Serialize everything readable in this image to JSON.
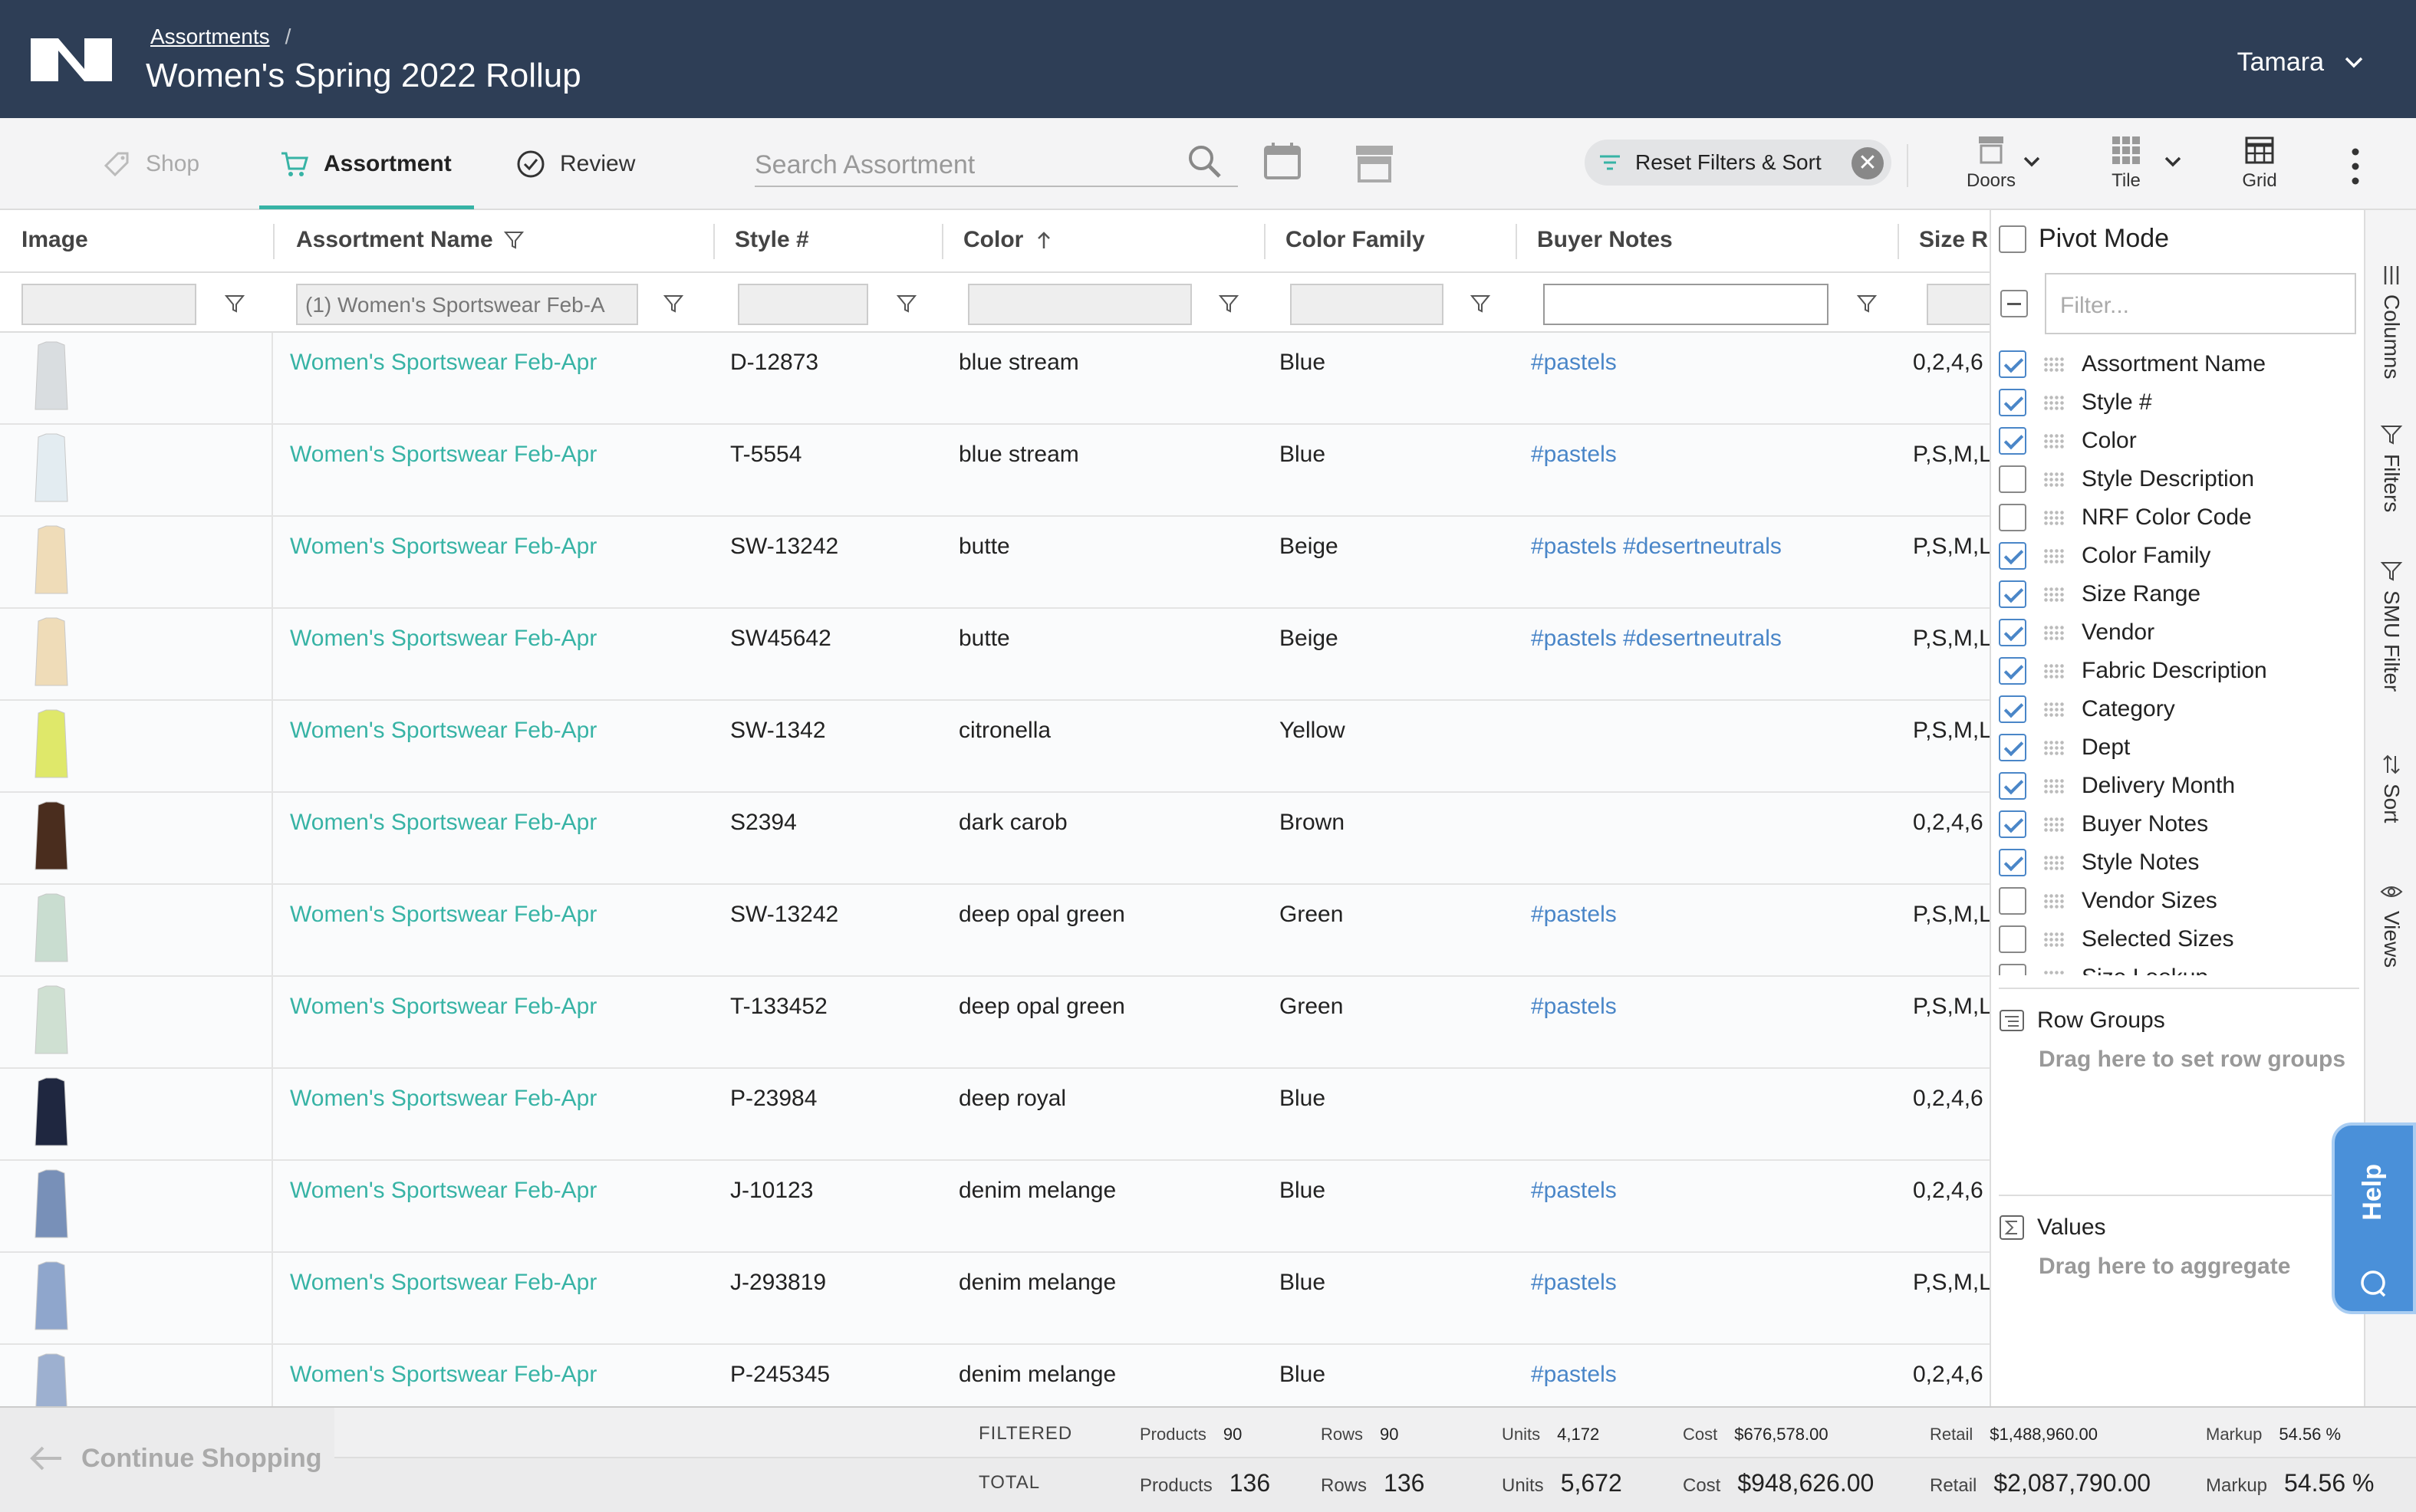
{
  "header": {
    "breadcrumb": "Assortments",
    "breadcrumb_sep": "/",
    "title": "Women's Spring 2022 Rollup",
    "user": "Tamara"
  },
  "toolbar": {
    "tabs": [
      {
        "label": "Shop",
        "icon": "tag-icon"
      },
      {
        "label": "Assortment",
        "icon": "cart-icon",
        "active": true
      },
      {
        "label": "Review",
        "icon": "check-circle-icon"
      }
    ],
    "search_placeholder": "Search Assortment",
    "reset_label": "Reset Filters & Sort",
    "doors_label": "Doors",
    "tile_label": "Tile",
    "grid_label": "Grid"
  },
  "grid": {
    "columns": [
      "Image",
      "Assortment Name",
      "Style #",
      "Color",
      "Color Family",
      "Buyer Notes",
      "Size R"
    ],
    "filters": {
      "assortment_name": "(1) Women's Sportswear Feb-A"
    },
    "rows": [
      {
        "name": "Women's Sportswear Feb-Apr",
        "style": "D-12873",
        "color": "blue stream",
        "family": "Blue",
        "notes": "#pastels",
        "size": "0,2,4,6",
        "thumb": "#d9dde0"
      },
      {
        "name": "Women's Sportswear Feb-Apr",
        "style": "T-5554",
        "color": "blue stream",
        "family": "Blue",
        "notes": "#pastels",
        "size": "P,S,M,L",
        "thumb": "#e3ecf1"
      },
      {
        "name": "Women's Sportswear Feb-Apr",
        "style": "SW-13242",
        "color": "butte",
        "family": "Beige",
        "notes": "#pastels #desertneutrals",
        "size": "P,S,M,L",
        "thumb": "#efdcb8"
      },
      {
        "name": "Women's Sportswear Feb-Apr",
        "style": "SW45642",
        "color": "butte",
        "family": "Beige",
        "notes": "#pastels #desertneutrals",
        "size": "P,S,M,L",
        "thumb": "#efdcb8"
      },
      {
        "name": "Women's Sportswear Feb-Apr",
        "style": "SW-1342",
        "color": "citronella",
        "family": "Yellow",
        "notes": "",
        "size": "P,S,M,L",
        "thumb": "#dfe86a"
      },
      {
        "name": "Women's Sportswear Feb-Apr",
        "style": "S2394",
        "color": "dark carob",
        "family": "Brown",
        "notes": "",
        "size": "0,2,4,6",
        "thumb": "#4a2d1e"
      },
      {
        "name": "Women's Sportswear Feb-Apr",
        "style": "SW-13242",
        "color": "deep opal green",
        "family": "Green",
        "notes": "#pastels",
        "size": "P,S,M,L",
        "thumb": "#c9ddd0"
      },
      {
        "name": "Women's Sportswear Feb-Apr",
        "style": "T-133452",
        "color": "deep opal green",
        "family": "Green",
        "notes": "#pastels",
        "size": "P,S,M,L",
        "thumb": "#cfe0d2"
      },
      {
        "name": "Women's Sportswear Feb-Apr",
        "style": "P-23984",
        "color": "deep royal",
        "family": "Blue",
        "notes": "",
        "size": "0,2,4,6",
        "thumb": "#1f2740"
      },
      {
        "name": "Women's Sportswear Feb-Apr",
        "style": "J-10123",
        "color": "denim melange",
        "family": "Blue",
        "notes": "#pastels",
        "size": "0,2,4,6",
        "thumb": "#7890b8"
      },
      {
        "name": "Women's Sportswear Feb-Apr",
        "style": "J-293819",
        "color": "denim melange",
        "family": "Blue",
        "notes": "#pastels",
        "size": "P,S,M,L",
        "thumb": "#8fa6cc"
      },
      {
        "name": "Women's Sportswear Feb-Apr",
        "style": "P-245345",
        "color": "denim melange",
        "family": "Blue",
        "notes": "#pastels",
        "size": "0,2,4,6",
        "thumb": "#9db0d0"
      }
    ]
  },
  "panel": {
    "pivot_mode": "Pivot Mode",
    "filter_placeholder": "Filter...",
    "columns": [
      {
        "label": "Assortment Name",
        "checked": true
      },
      {
        "label": "Style #",
        "checked": true
      },
      {
        "label": "Color",
        "checked": true
      },
      {
        "label": "Style Description",
        "checked": false
      },
      {
        "label": "NRF Color Code",
        "checked": false
      },
      {
        "label": "Color Family",
        "checked": true
      },
      {
        "label": "Size Range",
        "checked": true
      },
      {
        "label": "Vendor",
        "checked": true
      },
      {
        "label": "Fabric Description",
        "checked": true
      },
      {
        "label": "Category",
        "checked": true
      },
      {
        "label": "Dept",
        "checked": true
      },
      {
        "label": "Delivery Month",
        "checked": true
      },
      {
        "label": "Buyer Notes",
        "checked": true
      },
      {
        "label": "Style Notes",
        "checked": true
      },
      {
        "label": "Vendor Sizes",
        "checked": false
      },
      {
        "label": "Selected Sizes",
        "checked": false
      },
      {
        "label": "Size Lookup",
        "checked": false
      }
    ],
    "row_groups_title": "Row Groups",
    "row_groups_hint": "Drag here to set row groups",
    "values_title": "Values",
    "values_hint": "Drag here to aggregate"
  },
  "side_tabs": [
    "Columns",
    "Filters",
    "SMU Filter",
    "Sort",
    "Views"
  ],
  "help_label": "Help",
  "footer": {
    "continue": "Continue Shopping",
    "filtered": {
      "label": "FILTERED",
      "products_label": "Products",
      "products": "90",
      "rows_label": "Rows",
      "rows": "90",
      "units_label": "Units",
      "units": "4,172",
      "cost_label": "Cost",
      "cost": "$676,578.00",
      "retail_label": "Retail",
      "retail": "$1,488,960.00",
      "markup_label": "Markup",
      "markup": "54.56 %"
    },
    "total": {
      "label": "TOTAL",
      "products_label": "Products",
      "products": "136",
      "rows_label": "Rows",
      "rows": "136",
      "units_label": "Units",
      "units": "5,672",
      "cost_label": "Cost",
      "cost": "$948,626.00",
      "retail_label": "Retail",
      "retail": "$2,087,790.00",
      "markup_label": "Markup",
      "markup": "54.56 %"
    }
  },
  "colors": {
    "header_bg": "#2e3e56",
    "accent_teal": "#37b3a5",
    "tag_blue": "#4a86c8",
    "help_blue": "#4a90d9"
  }
}
